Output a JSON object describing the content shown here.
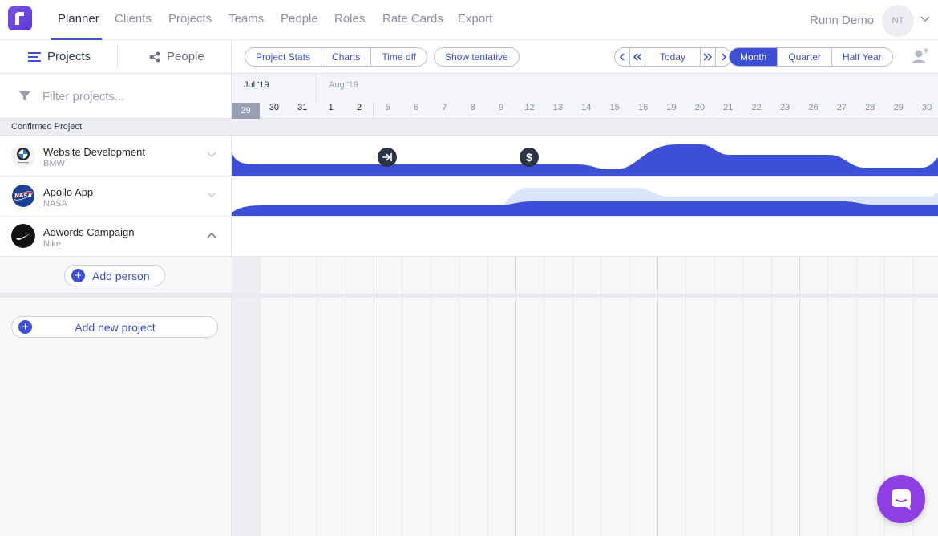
{
  "nav": {
    "items": [
      "Planner",
      "Clients",
      "Projects",
      "Teams",
      "People",
      "Roles",
      "Rate Cards",
      "Export"
    ],
    "user_name": "Runn Demo",
    "avatar_initials": "NT"
  },
  "toolbar": {
    "tab_projects": "Projects",
    "tab_people": "People",
    "view_buttons": [
      "Project Stats",
      "Charts",
      "Time off"
    ],
    "show_tentative": "Show tentative",
    "today": "Today",
    "periods": [
      "Month",
      "Quarter",
      "Half Year"
    ],
    "selected_period": "Month"
  },
  "filter": {
    "placeholder": "Filter projects..."
  },
  "calendar": {
    "months": [
      "Jul '19",
      "Aug '19"
    ],
    "days": [
      "29",
      "30",
      "31",
      "1",
      "2",
      "5",
      "6",
      "7",
      "8",
      "9",
      "12",
      "13",
      "14",
      "15",
      "16",
      "19",
      "20",
      "21",
      "22",
      "23",
      "26",
      "27",
      "28",
      "29",
      "30"
    ],
    "today_day": "29"
  },
  "group": {
    "label": "Confirmed Project"
  },
  "projects": [
    {
      "name": "Website Development",
      "client": "BMW",
      "logo": "bmw-logo",
      "expanded": false
    },
    {
      "name": "Apollo App",
      "client": "NASA",
      "logo": "nasa-logo",
      "expanded": false
    },
    {
      "name": "Adwords Campaign",
      "client": "Nike",
      "logo": "nike-logo",
      "expanded": true
    }
  ],
  "actions": {
    "add_person": "Add person",
    "add_project": "Add new project"
  },
  "colors": {
    "accent": "#3d4fd6",
    "tentative": "#dbe5fb",
    "logo": "#6a47de",
    "chat": "#8e3fe3"
  }
}
